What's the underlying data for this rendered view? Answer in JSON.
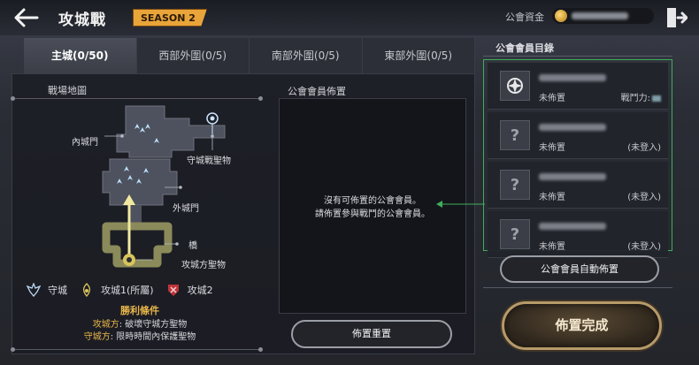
{
  "header": {
    "title": "攻城戰",
    "season_badge": "SEASON 2",
    "funds_label": "公會資金"
  },
  "tabs": [
    {
      "label": "主城(0/50)",
      "active": true
    },
    {
      "label": "西部外圍(0/5)",
      "active": false
    },
    {
      "label": "南部外圍(0/5)",
      "active": false
    },
    {
      "label": "東部外圍(0/5)",
      "active": false
    }
  ],
  "map": {
    "section_title": "戰場地圖",
    "labels": {
      "inner_gate": "內城門",
      "defender_relic": "守城戰聖物",
      "outer_gate": "外城門",
      "bridge": "橋",
      "attacker_relic": "攻城方聖物"
    },
    "legend": [
      {
        "label": "守城",
        "icon": "defender-icon"
      },
      {
        "label": "攻城1(所屬)",
        "icon": "attacker1-icon"
      },
      {
        "label": "攻城2",
        "icon": "attacker2-icon"
      }
    ]
  },
  "victory": {
    "title": "勝利條件",
    "attacker_role": "攻城方",
    "attacker_text": ": 破壞守城方聖物",
    "defender_role": "守城方",
    "defender_text": ": 限時時間內保護聖物"
  },
  "placement": {
    "section_title": "公會會員佈置",
    "empty_line1": "沒有可佈置的公會會員。",
    "empty_line2": "請佈置參與戰鬥的公會會員。",
    "reset_button": "佈置重置"
  },
  "roster": {
    "title": "公會會員目錄",
    "members": [
      {
        "status": "未佈置",
        "right_label": "戰鬥力:",
        "avatar": "emblem"
      },
      {
        "status": "未佈置",
        "right_label": "(未登入)",
        "avatar": "?"
      },
      {
        "status": "未佈置",
        "right_label": "(未登入)",
        "avatar": "?"
      },
      {
        "status": "未佈置",
        "right_label": "(未登入)",
        "avatar": "?"
      }
    ],
    "auto_button": "公會會員自動佈置"
  },
  "done_button": "佈置完成",
  "colors": {
    "accent_gold": "#e8b64a",
    "season_badge": "#e9a53a",
    "highlight_green": "#3fae5a"
  }
}
